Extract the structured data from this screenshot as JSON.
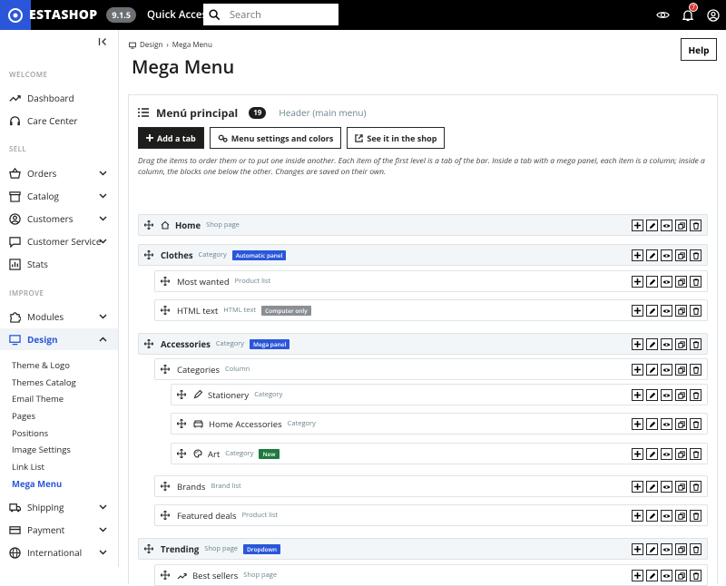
{
  "topbar": {
    "logo_text": "ESTASHOP",
    "version": "9.1.5",
    "quick_access": "Quick Access",
    "search_placeholder": "Search",
    "notif_count": "7"
  },
  "sidebar": {
    "welcome": "WELCOME",
    "dashboard": "Dashboard",
    "care": "Care Center",
    "sell": "SELL",
    "orders": "Orders",
    "catalog": "Catalog",
    "customers": "Customers",
    "customer_service": "Customer Service",
    "stats": "Stats",
    "improve": "IMPROVE",
    "modules": "Modules",
    "design": "Design",
    "subs": [
      "Theme & Logo",
      "Themes Catalog",
      "Email Theme",
      "Pages",
      "Positions",
      "Image Settings",
      "Link List",
      "Mega Menu"
    ],
    "shipping": "Shipping",
    "payment": "Payment",
    "international": "International"
  },
  "breadcrumb": {
    "parent": "Design",
    "current": "Mega Menu"
  },
  "page_title": "Mega Menu",
  "help": "Help",
  "panel": {
    "title": "Menú principal",
    "count": "19",
    "header_label": "Header (main menu)"
  },
  "buttons": {
    "add": "Add a tab",
    "settings": "Menu settings and colors",
    "see": "See it in the shop"
  },
  "description": "Drag the items to order them or to put one inside another. Each item of the first level is a tab of the bar. Inside a tab with a mega panel, each item is a column; inside a column, the blocks one below the other. Changes are saved on their own.",
  "colors": {
    "blue": "#2a57d9",
    "gray": "#8a8f94",
    "green": "#1e7a3e"
  },
  "items": [
    {
      "name": "Home",
      "type": "Shop page",
      "tag": "",
      "icon": "home-icon"
    },
    {
      "name": "Clothes",
      "type": "Category",
      "tag": "Automatic panel"
    },
    {
      "name": "Most wanted",
      "type": "Product list",
      "tag": ""
    },
    {
      "name": "HTML text",
      "type": "HTML text",
      "tag": "Computer only"
    },
    {
      "name": "Accessories",
      "type": "Category",
      "tag": "Mega panel"
    },
    {
      "name": "Categories",
      "type": "Column",
      "tag": ""
    },
    {
      "name": "Stationery",
      "type": "Category",
      "tag": "",
      "icon": "pencil-icon"
    },
    {
      "name": "Home Accessories",
      "type": "Category",
      "tag": "",
      "icon": "sofa-icon"
    },
    {
      "name": "Art",
      "type": "Category",
      "tag": "New",
      "icon": "palette-icon"
    },
    {
      "name": "Brands",
      "type": "Brand list",
      "tag": ""
    },
    {
      "name": "Featured deals",
      "type": "Product list",
      "tag": ""
    },
    {
      "name": "Trending",
      "type": "Shop page",
      "tag": "Dropdown"
    },
    {
      "name": "Best sellers",
      "type": "Shop page",
      "tag": "",
      "icon": "trend-icon"
    }
  ]
}
